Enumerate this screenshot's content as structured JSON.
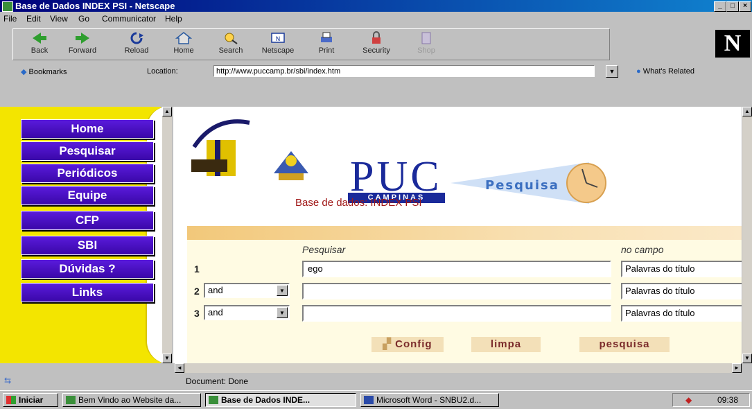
{
  "window": {
    "title": "Base de Dados INDEX PSI - Netscape"
  },
  "menu": [
    "File",
    "Edit",
    "View",
    "Go",
    "Communicator",
    "Help"
  ],
  "toolbar": {
    "buttons": [
      "Back",
      "Forward",
      "Reload",
      "Home",
      "Search",
      "Netscape",
      "Print",
      "Security",
      "Shop"
    ],
    "bookmarks_label": "Bookmarks",
    "location_label": "Location:",
    "location_value": "http://www.puccamp.br/sbi/index.htm",
    "whats_related": "What's Related",
    "brand": "N"
  },
  "sidebar": {
    "items": [
      "Home",
      "Pesquisar",
      "Periódicos",
      "Equipe",
      "CFP",
      "SBI",
      "Dúvidas ?",
      "Links"
    ]
  },
  "header": {
    "logo_text": "PUC",
    "logo_sub": "CAMPINAS",
    "tagline": "Pesquisa",
    "subtitle": "Base de dados:  INDEX PSI"
  },
  "form": {
    "col_search": "Pesquisar",
    "col_field": "no campo",
    "rows": [
      {
        "num": "1",
        "operator": "",
        "term": "ego",
        "field": "Palavras do título"
      },
      {
        "num": "2",
        "operator": "and",
        "term": "",
        "field": "Palavras do título"
      },
      {
        "num": "3",
        "operator": "and",
        "term": "",
        "field": "Palavras do título"
      }
    ],
    "buttons": {
      "config": "Config",
      "clear": "limpa",
      "search": "pesquisa"
    }
  },
  "status": {
    "text": "Document: Done"
  },
  "taskbar": {
    "start": "Iniciar",
    "items": [
      {
        "label": "Bem Vindo ao Website da...",
        "active": false
      },
      {
        "label": "Base de Dados INDE...",
        "active": true
      },
      {
        "label": "Microsoft Word - SNBU2.d...",
        "active": false
      }
    ],
    "clock": "09:38"
  },
  "colors": {
    "titlebar": "#00007b",
    "sidebar_bg": "#f3e500",
    "nav_button": "#3a07a8",
    "puc_blue": "#1a2a9a",
    "subtitle_red": "#a01818"
  }
}
